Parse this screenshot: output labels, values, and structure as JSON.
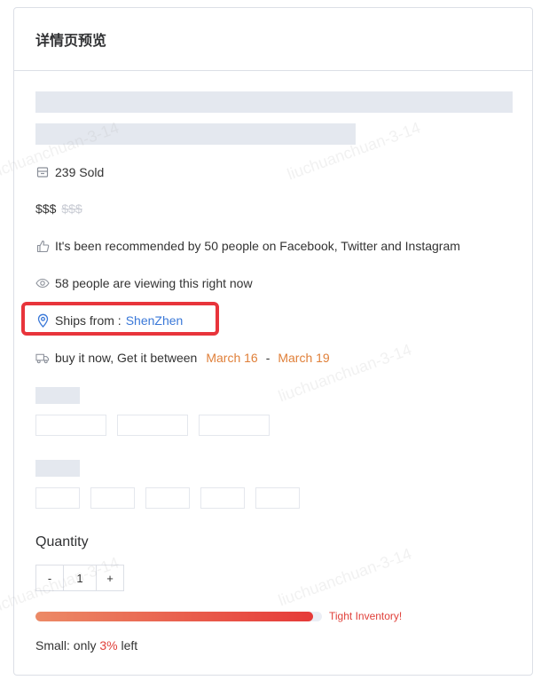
{
  "header": {
    "title": "详情页预览"
  },
  "sold": {
    "text": "239 Sold"
  },
  "price": {
    "current": "$$$",
    "original": "$$$"
  },
  "recommend": {
    "text": "It's been recommended by 50 people on Facebook, Twitter and Instagram"
  },
  "viewing": {
    "text": "58 people are viewing this right now"
  },
  "ships": {
    "label": "Ships from :",
    "location": "ShenZhen"
  },
  "delivery": {
    "prefix": "buy it now, Get it between",
    "start": "March 16",
    "sep": "-",
    "end": "March 19"
  },
  "quantity": {
    "label": "Quantity",
    "minus": "-",
    "value": "1",
    "plus": "+"
  },
  "inventory": {
    "label": "Tight Inventory!",
    "level_fraction": 0.97
  },
  "stock": {
    "prefix": "Small: only",
    "percent": "3%",
    "suffix": "left"
  },
  "watermark": {
    "text": "liuchuanchuan-3-14"
  },
  "colors": {
    "accent_blue": "#3a78d8",
    "accent_orange": "#e0803a",
    "alert_red": "#e0403a",
    "highlight_red": "#e8343b"
  },
  "icons": [
    "box-icon",
    "thumbs-up-icon",
    "eye-icon",
    "location-pin-icon",
    "truck-icon"
  ]
}
